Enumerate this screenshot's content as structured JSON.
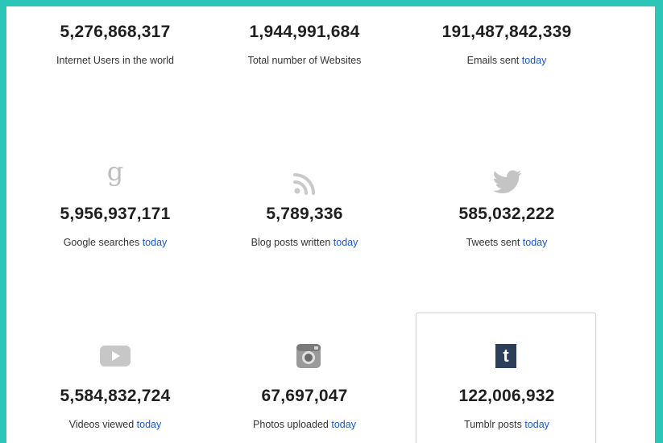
{
  "stats": {
    "internet_users": {
      "value": "5,276,868,317",
      "label": "Internet Users in the world"
    },
    "websites": {
      "value": "1,944,991,684",
      "label": "Total number of Websites"
    },
    "emails": {
      "value": "191,487,842,339",
      "label": "Emails sent",
      "suffix": "today"
    },
    "google": {
      "value": "5,956,937,171",
      "label": "Google searches",
      "suffix": "today",
      "icon": "google-g-icon"
    },
    "blog": {
      "value": "5,789,336",
      "label": "Blog posts written",
      "suffix": "today",
      "icon": "rss-icon"
    },
    "tweets": {
      "value": "585,032,222",
      "label": "Tweets sent",
      "suffix": "today",
      "icon": "twitter-bird-icon"
    },
    "videos": {
      "value": "5,584,832,724",
      "label": "Videos viewed",
      "suffix": "today",
      "icon": "youtube-play-icon"
    },
    "photos": {
      "value": "67,697,047",
      "label": "Photos uploaded",
      "suffix": "today",
      "icon": "instagram-camera-icon"
    },
    "tumblr": {
      "value": "122,006,932",
      "label": "Tumblr posts",
      "suffix": "today",
      "icon": "tumblr-icon",
      "icon_glyph": "t"
    }
  },
  "colors": {
    "frame": "#2bc6b7",
    "link": "#1a57c8",
    "icon_gray": "#bdbdbd",
    "tumblr_bg": "#2c3e5a"
  }
}
